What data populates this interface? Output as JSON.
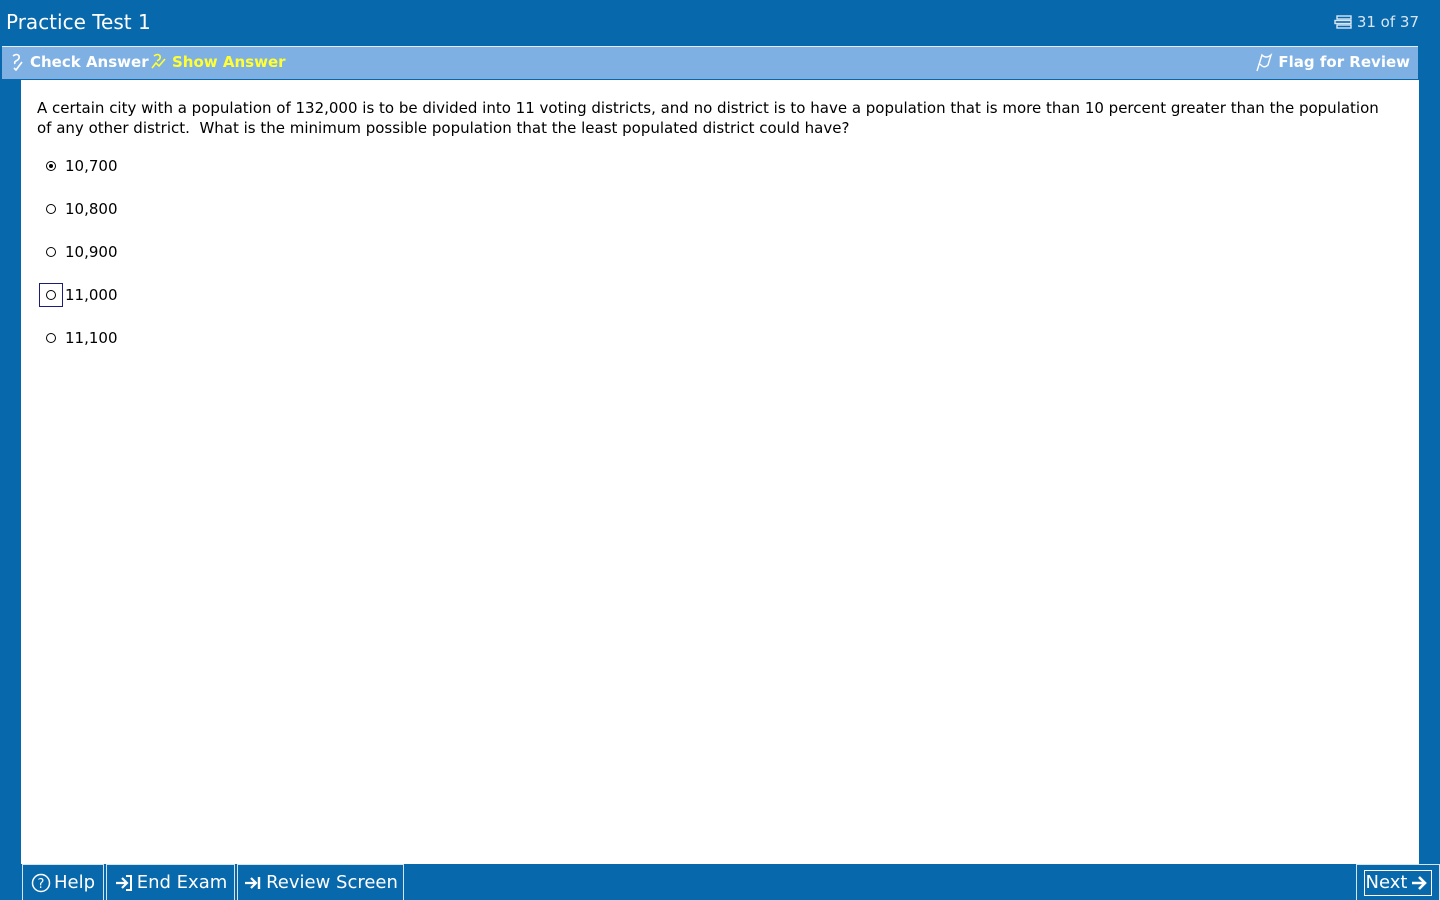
{
  "window": {
    "title": "Practice Test 1",
    "progress": "31 of 37",
    "progress_icon": "question-list-icon"
  },
  "toolbar": {
    "check_answer": "Check Answer",
    "show_answer": "Show Answer",
    "flag_for_review": "Flag for Review",
    "check_icon": "check-answer-icon",
    "show_icon": "show-answer-icon",
    "flag_icon": "flag-icon"
  },
  "question": {
    "text": "A certain city with a population of 132,000 is to be divided into 11 voting districts, and no district is to have a population that is more than 10 percent greater than the population of any other district.  What is the minimum possible population that the least populated district could have?",
    "options": [
      {
        "label": "10,700",
        "selected": true,
        "focused": false
      },
      {
        "label": "10,800",
        "selected": false,
        "focused": false
      },
      {
        "label": "10,900",
        "selected": false,
        "focused": false
      },
      {
        "label": "11,000",
        "selected": false,
        "focused": true
      },
      {
        "label": "11,100",
        "selected": false,
        "focused": false
      }
    ]
  },
  "bottom": {
    "help": "Help",
    "end_exam": "End Exam",
    "review_screen": "Review Screen",
    "next": "Next"
  },
  "colors": {
    "frame_blue": "#0768ac",
    "toolbar_blue": "#7fb0e3",
    "show_answer_yellow": "#ffff33"
  }
}
